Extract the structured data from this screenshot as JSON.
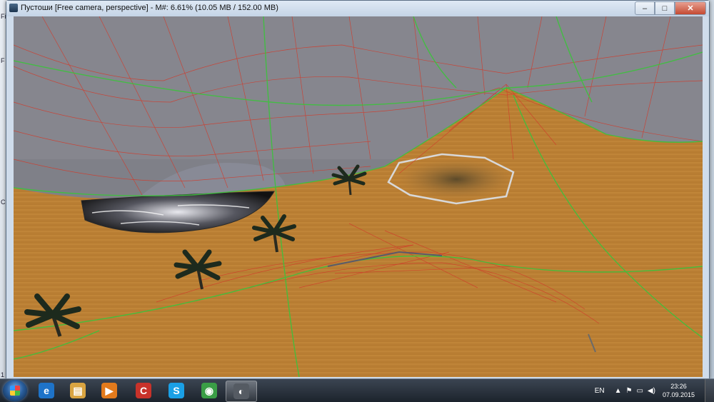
{
  "window": {
    "title": "Пустоши [Free camera, perspective] - M#: 6.61% (10.05 MB / 152.00 MB)",
    "controls": {
      "minimize": "–",
      "maximize": "□",
      "close": "✕"
    }
  },
  "background_app": {
    "fragments": [
      "Fi",
      "F",
      "C",
      "1 tr"
    ]
  },
  "taskbar": {
    "apps": [
      {
        "name": "internet-explorer-icon",
        "glyph": "e",
        "color": "#1e73c8"
      },
      {
        "name": "file-explorer-icon",
        "glyph": "▤",
        "color": "#d9a441"
      },
      {
        "name": "media-player-icon",
        "glyph": "▶",
        "color": "#e27a1c"
      },
      {
        "name": "ccleaner-icon",
        "glyph": "C",
        "color": "#c8322a"
      },
      {
        "name": "skype-icon",
        "glyph": "S",
        "color": "#1aa0e6"
      },
      {
        "name": "chrome-icon",
        "glyph": "◉",
        "color": "#3a9e46"
      },
      {
        "name": "editor-app-icon",
        "glyph": "◐",
        "color": "#555b63"
      }
    ],
    "tray": {
      "language": "EN",
      "time": "23:26",
      "date": "07.09.2015"
    }
  },
  "scene": {
    "sky_color": "#7f8088",
    "sand_color": "#c98d3c",
    "water_color": "#141418",
    "wire_red": "#d23a2a",
    "wire_green": "#3cc23c"
  }
}
